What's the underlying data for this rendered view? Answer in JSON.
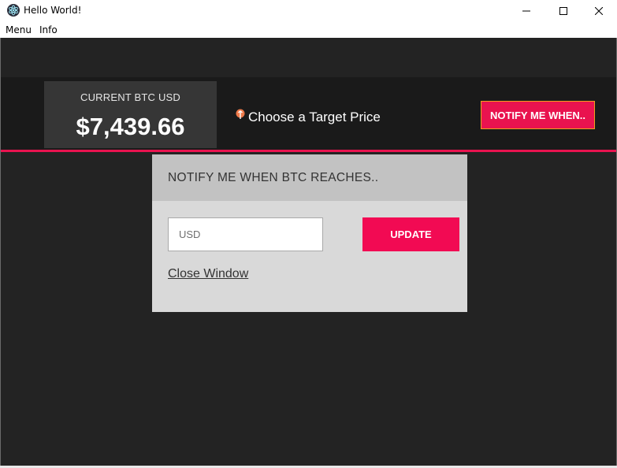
{
  "window": {
    "title": "Hello World!",
    "icon": "electron-icon",
    "controls": [
      "minimize-icon",
      "maximize-icon",
      "close-icon"
    ]
  },
  "menubar": {
    "items": [
      "Menu",
      "Info"
    ]
  },
  "header": {
    "price_label": "CURRENT BTC USD",
    "price_value": "$7,439.66",
    "target_icon": "pin-icon",
    "target_text": "Choose a Target Price",
    "notify_button": "NOTIFY ME WHEN.."
  },
  "modal": {
    "title": "NOTIFY ME WHEN BTC REACHES..",
    "input_placeholder": "USD",
    "input_value": "",
    "update_button": "UPDATE",
    "close_link": "Close Window"
  },
  "colors": {
    "app_background": "#232323",
    "header_background": "#1a1a1a",
    "accent": "#e9134f",
    "price_box": "#363636",
    "modal_body": "#d9d9d9",
    "modal_header": "#c2c2c2"
  }
}
